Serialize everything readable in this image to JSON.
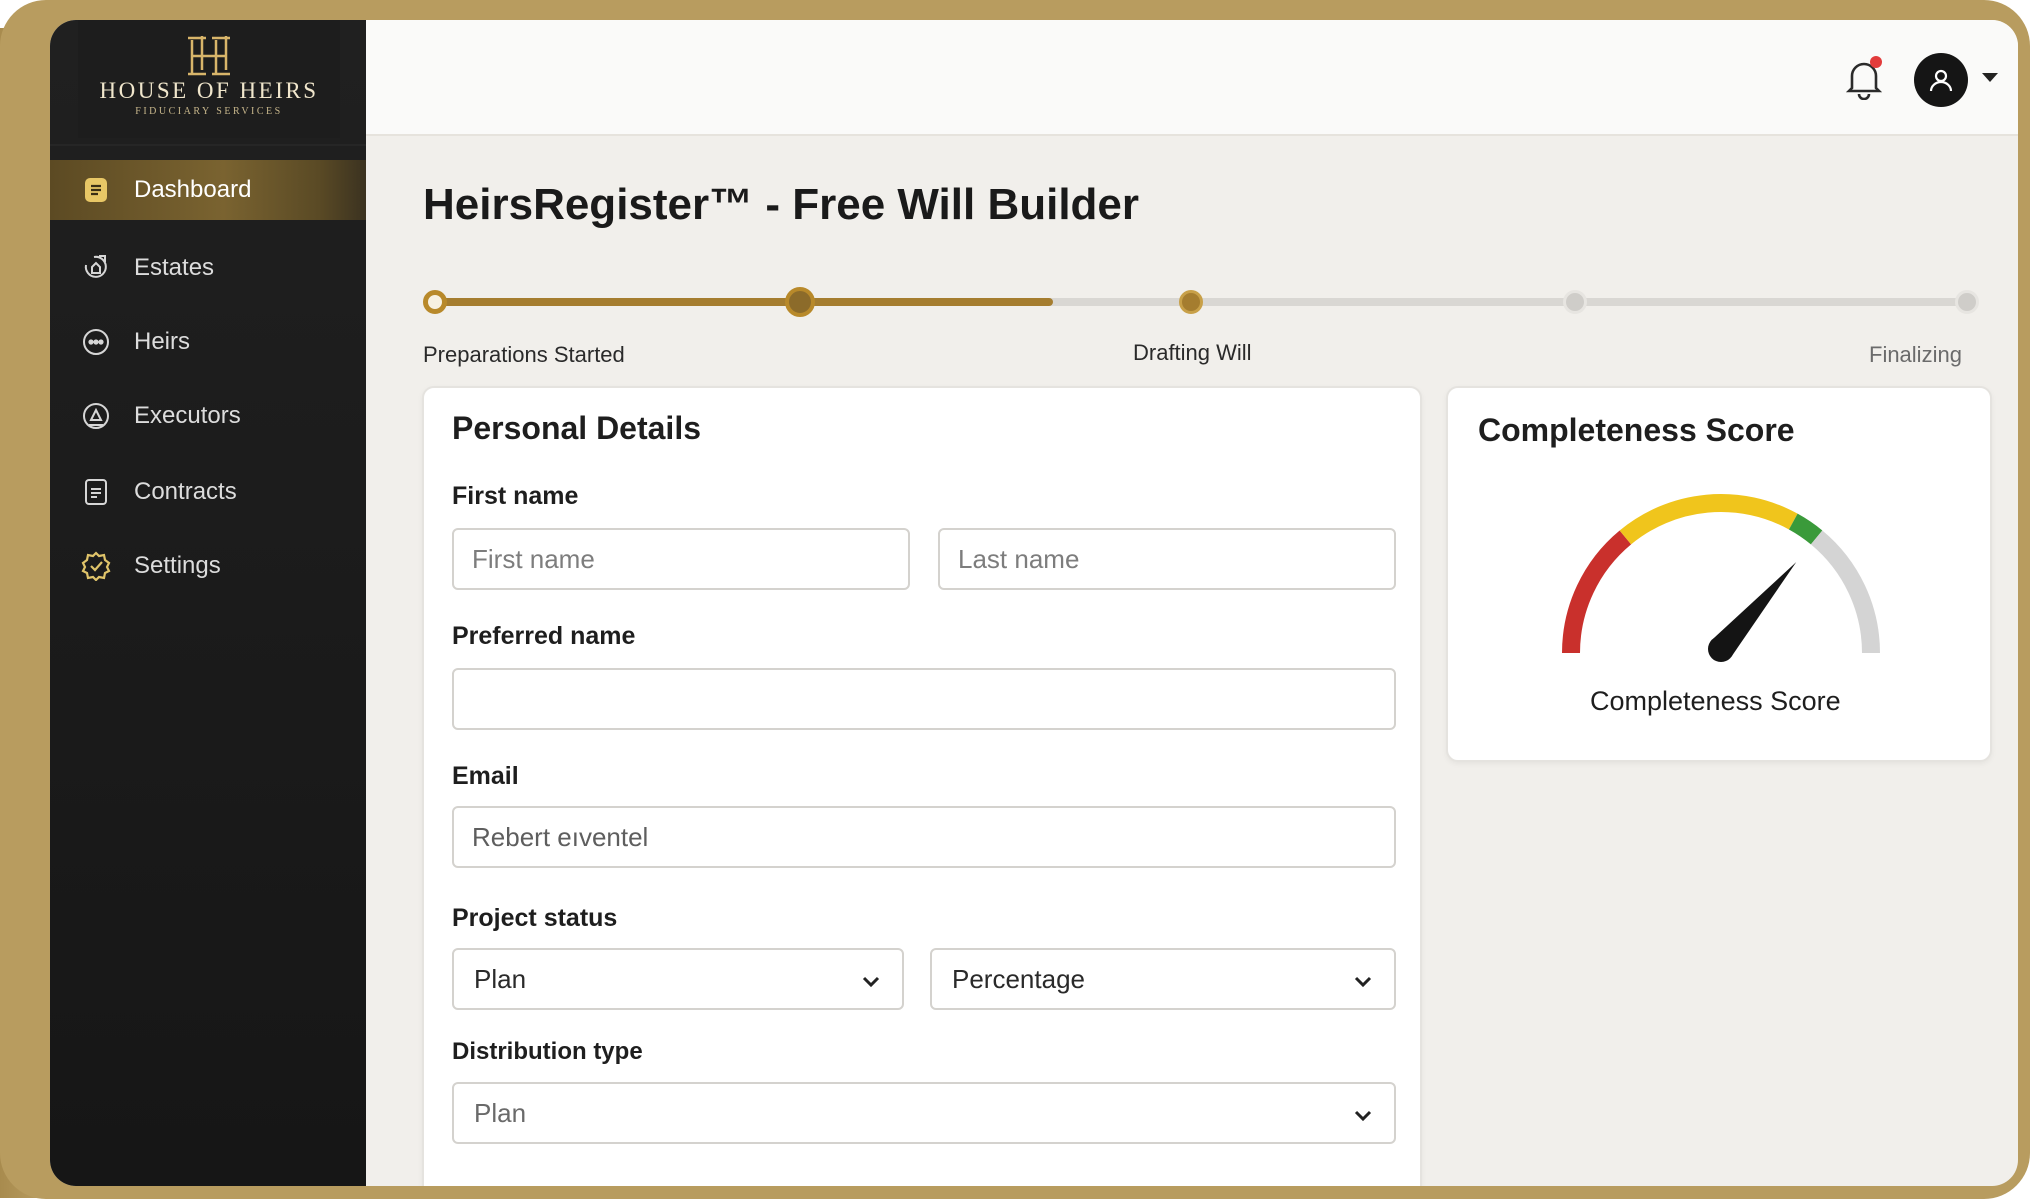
{
  "brand": {
    "title": "HOUSE OF HEIRS",
    "subtitle": "FIDUCIARY SERVICES",
    "mark": "HH"
  },
  "sidebar": {
    "items": [
      {
        "label": "Dashboard",
        "icon": "dashboard-icon",
        "active": true
      },
      {
        "label": "Estates",
        "icon": "estates-icon",
        "active": false
      },
      {
        "label": "Heirs",
        "icon": "heirs-icon",
        "active": false
      },
      {
        "label": "Executors",
        "icon": "executors-icon",
        "active": false
      },
      {
        "label": "Contracts",
        "icon": "contracts-icon",
        "active": false
      },
      {
        "label": "Settings",
        "icon": "settings-icon",
        "active": false
      }
    ]
  },
  "header": {
    "notification_icon": "bell-icon",
    "has_unread_notifications": true,
    "user_icon": "user-icon"
  },
  "page": {
    "title": "HeirsRegister™ - Free Will Builder"
  },
  "progress": {
    "steps": [
      {
        "label": "Preparations Started"
      },
      {
        "label": "Drafting Will"
      },
      {
        "label": "Finalizing"
      }
    ],
    "completed_fraction": 0.4
  },
  "personal_details": {
    "title": "Personal Details",
    "first_name_label": "First name",
    "first_name_placeholder": "First name",
    "last_name_placeholder": "Last name",
    "preferred_name_label": "Preferred name",
    "preferred_name_value": "",
    "email_label": "Email",
    "email_value": "Rebert eıventel",
    "project_status_label": "Project status",
    "project_status_value": "Plan",
    "project_status_unit": "Percentage",
    "distribution_type_label": "Distribution type",
    "distribution_type_value": "Plan"
  },
  "completeness": {
    "title": "Completeness Score",
    "gauge_label": "Completeness Score",
    "score_fraction": 0.72,
    "colors": {
      "red": "#c9302c",
      "yellow": "#f0c51c",
      "green": "#3a9a3a",
      "gray": "#d4d4d4"
    }
  },
  "theme": {
    "accent": "#a57d2f",
    "sidebar": "#1c1c1c",
    "frame": "#b89c5f"
  }
}
